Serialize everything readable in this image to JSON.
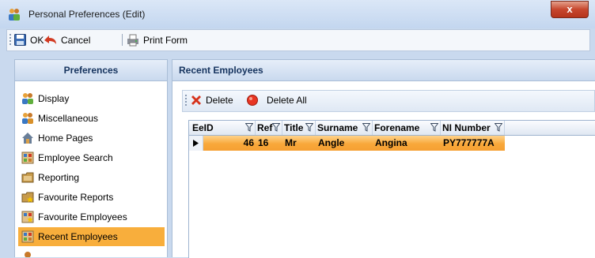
{
  "window": {
    "title": "Personal Preferences (Edit)",
    "close_label": "x"
  },
  "toolbar": {
    "ok_label": "OK",
    "cancel_label": "Cancel",
    "print_label": "Print Form"
  },
  "sidebar": {
    "header": "Preferences",
    "items": [
      {
        "label": "Display",
        "icon": "display-people-icon"
      },
      {
        "label": "Miscellaneous",
        "icon": "misc-people-icon"
      },
      {
        "label": "Home Pages",
        "icon": "home-pages-icon"
      },
      {
        "label": "Employee Search",
        "icon": "employee-search-icon"
      },
      {
        "label": "Reporting",
        "icon": "reporting-icon"
      },
      {
        "label": "Favourite Reports",
        "icon": "favourite-reports-icon"
      },
      {
        "label": "Favourite Employees",
        "icon": "favourite-employees-icon"
      },
      {
        "label": "Recent Employees",
        "icon": "recent-employees-icon",
        "selected": true
      }
    ]
  },
  "main": {
    "title": "Recent Employees",
    "actions": {
      "delete_label": "Delete",
      "delete_all_label": "Delete All"
    },
    "table": {
      "columns": [
        "EeID",
        "Ref",
        "Title",
        "Surname",
        "Forename",
        "NI Number"
      ],
      "rows": [
        {
          "eeid": "46",
          "ref": "16",
          "title": "Mr",
          "surname": "Angle",
          "forename": "Angina",
          "ni_number": "PY777777A"
        }
      ]
    }
  },
  "colors": {
    "selection": "#f8ae3c",
    "header_text": "#15335e",
    "close_button": "#c7472e"
  }
}
